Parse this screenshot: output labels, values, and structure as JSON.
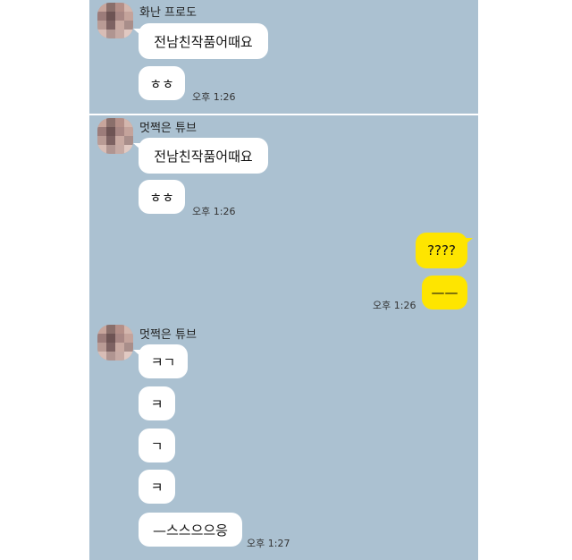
{
  "chat1": {
    "sender": "화난 프로도",
    "messages": [
      "전남친작품어때요",
      "ㅎㅎ"
    ],
    "time": "오후 1:26"
  },
  "chat2": {
    "sender": "멋쩍은 튜브",
    "messages": [
      "전남친작품어때요",
      "ㅎㅎ"
    ],
    "time": "오후 1:26",
    "my_messages": [
      "????",
      "——"
    ],
    "my_time": "오후 1:26",
    "sender2": "멋쩍은 튜브",
    "messages2": [
      "ㅋㄱ",
      "ㅋ",
      "ㄱ",
      "ㅋ",
      "—스스으으응"
    ],
    "time2": "오후 1:27"
  },
  "colors": {
    "chat_bg": "#abc1d1",
    "my_bubble": "#fee500",
    "their_bubble": "#ffffff"
  }
}
